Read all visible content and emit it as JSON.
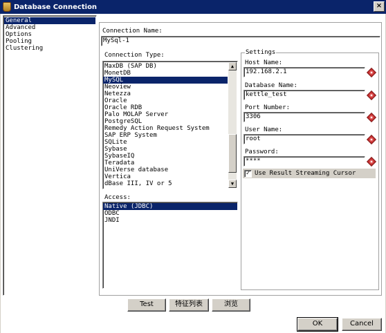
{
  "window": {
    "title": "Database Connection",
    "close_label": "×"
  },
  "nav": {
    "items": [
      {
        "label": "General",
        "selected": true
      },
      {
        "label": "Advanced",
        "selected": false
      },
      {
        "label": "Options",
        "selected": false
      },
      {
        "label": "Pooling",
        "selected": false
      },
      {
        "label": "Clustering",
        "selected": false
      }
    ]
  },
  "general": {
    "connection_name_label": "Connection Name:",
    "connection_name_value": "MySql-1",
    "connection_type_label": "Connection Type:",
    "connection_types": [
      "MaxDB (SAP DB)",
      "MonetDB",
      "MySQL",
      "Neoview",
      "Netezza",
      "Oracle",
      "Oracle RDB",
      "Palo MOLAP Server",
      "PostgreSQL",
      "Remedy Action Request System",
      "SAP ERP System",
      "SQLite",
      "Sybase",
      "SybaseIQ",
      "Teradata",
      "UniVerse database",
      "Vertica",
      "dBase III, IV or 5"
    ],
    "connection_type_selected": "MySQL",
    "access_label": "Access:",
    "access_types": [
      "Native (JDBC)",
      "ODBC",
      "JNDI"
    ],
    "access_selected": "Native (JDBC)"
  },
  "settings": {
    "legend": "Settings",
    "host_label": "Host Name:",
    "host_value": "192.168.2.1",
    "db_label": "Database Name:",
    "db_value": "kettle_test",
    "port_label": "Port Number:",
    "port_value": "3306",
    "user_label": "User Name:",
    "user_value": "root",
    "password_label": "Password:",
    "password_value": "****",
    "streaming_label": "Use Result Streaming Cursor",
    "streaming_checked": true
  },
  "buttons": {
    "test": "Test",
    "features": "特征列表",
    "explore": "浏览",
    "ok": "OK",
    "cancel": "Cancel"
  }
}
